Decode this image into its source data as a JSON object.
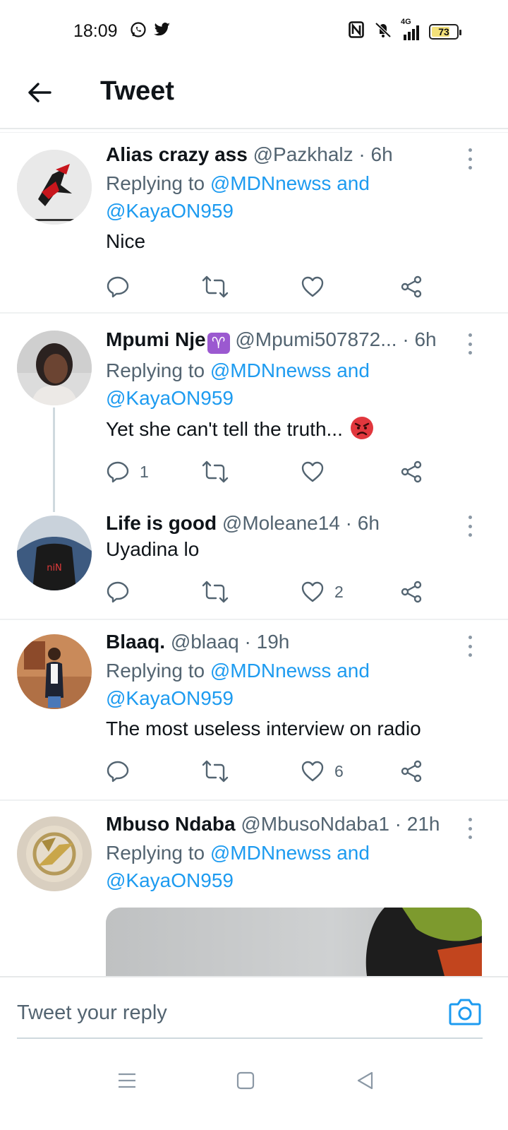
{
  "status_bar": {
    "time": "18:09",
    "app_icons": [
      "whatsapp-icon",
      "twitter-icon"
    ],
    "system_icons": [
      "nfc-icon",
      "mute-icon",
      "signal-4g-icon"
    ],
    "network": "4G",
    "battery": "73",
    "battery_level": 0.73
  },
  "header": {
    "title": "Tweet",
    "back_icon": "arrow-left-icon"
  },
  "tweets": [
    {
      "name": "Alias crazy ass",
      "handle": "@Pazkhalz",
      "time": "· 6h",
      "replying_prefix": "Replying to ",
      "replying_to_1": "@MDNnewss and",
      "replying_to_2": "@KayaON959",
      "text": "Nice",
      "reply_count": "",
      "retweet_count": "",
      "like_count": ""
    },
    {
      "name": "Mpumi Nje",
      "name_emoji": "♈",
      "handle": "@Mpumi507872...",
      "time": "· 6h",
      "replying_prefix": "Replying to ",
      "replying_to_1": "@MDNnewss and",
      "replying_to_2": "@KayaON959",
      "text": "Yet she can't tell the truth...",
      "text_emoji": "angry-face",
      "reply_count": "1",
      "retweet_count": "",
      "like_count": ""
    },
    {
      "name": "Life is good",
      "handle": "@Moleane14",
      "time": "· 6h",
      "text": "Uyadina lo",
      "reply_count": "",
      "retweet_count": "",
      "like_count": "2"
    },
    {
      "name": "Blaaq.",
      "handle": "@blaaq",
      "time": "· 19h",
      "replying_prefix": "Replying to ",
      "replying_to_1": "@MDNnewss and",
      "replying_to_2": "@KayaON959",
      "text": "The most useless interview on radio",
      "reply_count": "",
      "retweet_count": "",
      "like_count": "6"
    },
    {
      "name": "Mbuso Ndaba",
      "handle": "@MbusoNdaba1",
      "time": "· 21h",
      "replying_prefix": "Replying to ",
      "replying_to_1": "@MDNnewss and",
      "replying_to_2": "@KayaON959"
    }
  ],
  "composer": {
    "placeholder": "Tweet your reply",
    "camera_icon": "camera-icon"
  },
  "nav": [
    "menu-icon",
    "home-square-icon",
    "back-triangle-icon"
  ],
  "colors": {
    "accent": "#1d9bf0",
    "text": "#0f1419",
    "secondary": "#536471",
    "divider": "#eff1f2"
  }
}
